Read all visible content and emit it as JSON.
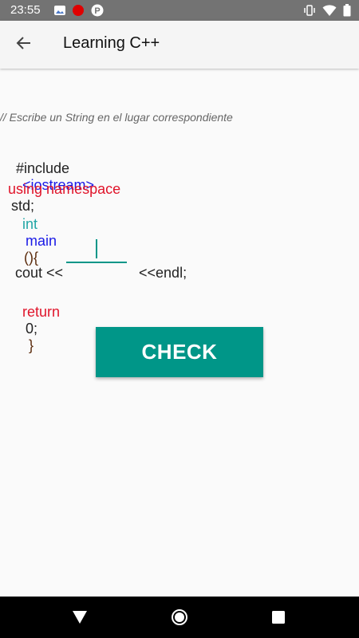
{
  "status_bar": {
    "time": "23:55",
    "notification_icons": [
      "gallery-icon",
      "record-icon",
      "p-icon"
    ],
    "p_icon_text": "P",
    "system_icons": [
      "vibrate-icon",
      "wifi-icon",
      "battery-icon"
    ]
  },
  "app_bar": {
    "back_icon": "arrow-left-icon",
    "title": "Learning C++"
  },
  "instruction_comment": "// Escribe un String en el lugar correspondiente",
  "code": {
    "include_kw": "#include",
    "include_lib": "<iostream>",
    "using_kw": "using namespace",
    "std": "std;",
    "int_kw": "int",
    "main_fn": "main",
    "main_parens": "(){",
    "cout_kw": "cout <<",
    "endl_part": "<<endl;",
    "return_kw": "return",
    "return_val": "0;",
    "close_brace": "}"
  },
  "answer_input": {
    "value": "",
    "placeholder": ""
  },
  "check_button": {
    "label": "CHECK"
  },
  "colors": {
    "accent": "#009688",
    "keyword_red": "#e0142a",
    "keyword_blue": "#1a1ae6",
    "keyword_teal": "#22a6a6"
  },
  "nav_bar": {
    "icons": [
      "back-triangle-icon",
      "home-circle-icon",
      "recents-square-icon"
    ]
  }
}
